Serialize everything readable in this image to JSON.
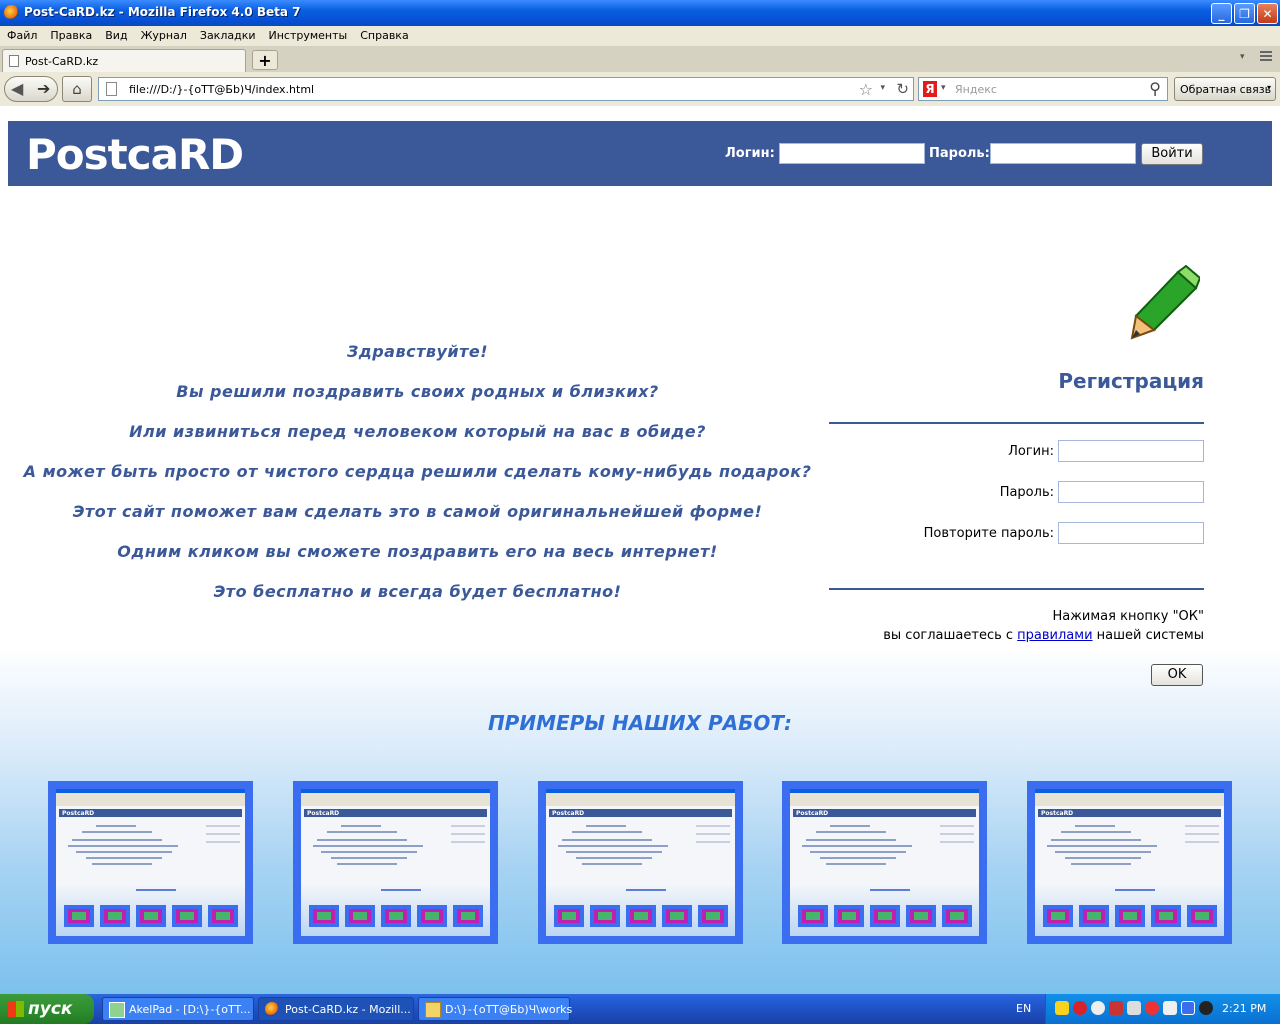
{
  "window": {
    "title": "Post-CaRD.kz - Mozilla Firefox 4.0 Beta 7",
    "minimize": "_",
    "maximize": "❐",
    "close": "✕"
  },
  "menu": [
    "Файл",
    "Правка",
    "Вид",
    "Журнал",
    "Закладки",
    "Инструменты",
    "Справка"
  ],
  "tab": {
    "label": "Post-CaRD.kz",
    "new_tab": "+"
  },
  "nav": {
    "url": "file:///D:/}-{oTT@Бb)Ч/index.html",
    "search_placeholder": "Яндекс",
    "feedback_label": "Обратная связь",
    "search_engine_letter": "Я"
  },
  "site": {
    "logo": "PostcaRD",
    "login_label": "Логин:",
    "password_label": "Пароль:",
    "login_button": "Войти"
  },
  "welcome_lines": [
    "Здравствуйте!",
    "Вы решили поздравить своих родных и близких?",
    "Или извиниться перед человеком который на вас в обиде?",
    "А может быть просто от чистого сердца решили сделать кому-нибудь подарок?",
    "Этот сайт поможет вам сделать это в самой оригинальнейшей форме!",
    "Одним кликом вы сможете поздравить его на весь интернет!",
    "Это бесплатно и всегда будет бесплатно!"
  ],
  "registration": {
    "title": "Регистрация",
    "login_label": "Логин:",
    "password_label": "Пароль:",
    "repeat_password_label": "Повторите пароль:",
    "note_line1": "Нажимая кнопку \"ОК\"",
    "note_prefix": "вы соглашаетесь с ",
    "note_link": "правилами",
    "note_suffix": " нашей системы",
    "ok_button": "OK"
  },
  "examples_title": "ПРИМЕРЫ НАШИХ РАБОТ:",
  "example_thumb_logo": "PostcaRD",
  "taskbar": {
    "start": "пуск",
    "tasks": [
      "AkelPad - [D:\\}-{oTT...",
      "Post-CaRD.kz - Mozill...",
      "D:\\}-{oTT@Бb)Ч\\works"
    ],
    "lang": "EN",
    "clock": "2:21 PM"
  }
}
